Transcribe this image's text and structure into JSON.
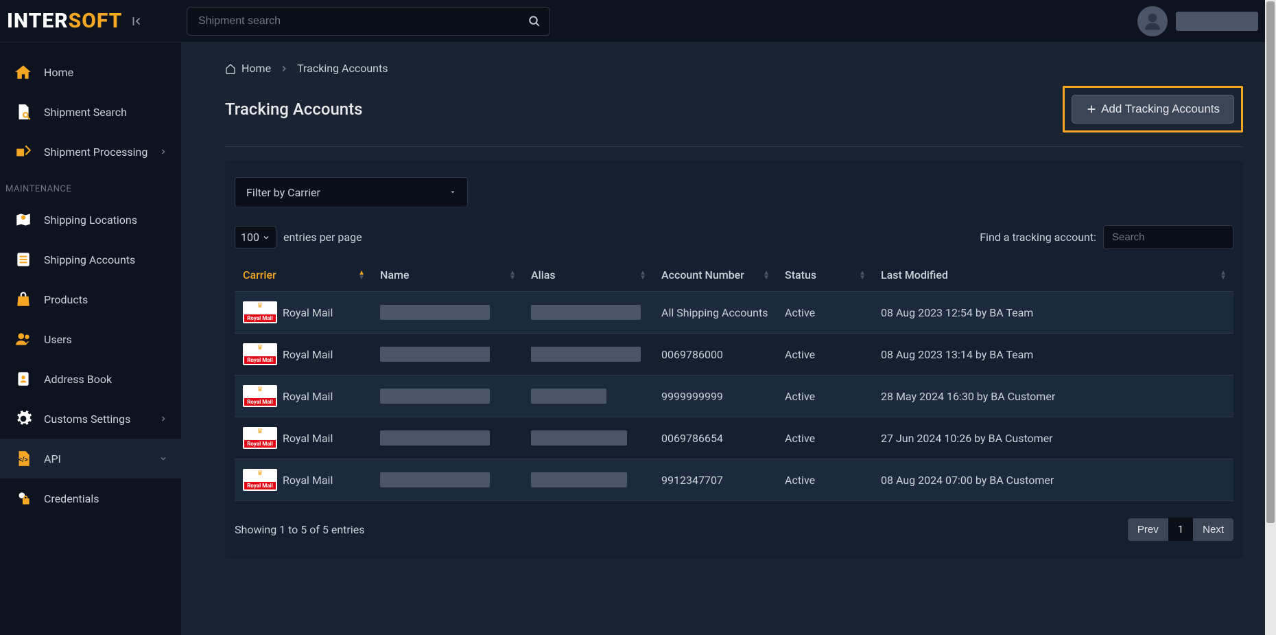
{
  "brand": {
    "part1": "INTER",
    "part2": "SOFT"
  },
  "topbar": {
    "search_placeholder": "Shipment search"
  },
  "sidebar": {
    "items_top": [
      {
        "label": "Home",
        "icon": "home"
      },
      {
        "label": "Shipment Search",
        "icon": "file-search"
      },
      {
        "label": "Shipment Processing",
        "icon": "process",
        "chevron": true
      }
    ],
    "section_label": "MAINTENANCE",
    "items_maint": [
      {
        "label": "Shipping Locations",
        "icon": "map-pin"
      },
      {
        "label": "Shipping Accounts",
        "icon": "list"
      },
      {
        "label": "Products",
        "icon": "bag"
      },
      {
        "label": "Users",
        "icon": "users"
      },
      {
        "label": "Address Book",
        "icon": "book"
      },
      {
        "label": "Customs Settings",
        "icon": "gear",
        "chevron": true
      },
      {
        "label": "API",
        "icon": "code",
        "chevron": true,
        "active": true
      },
      {
        "label": "Credentials",
        "icon": "lock"
      }
    ]
  },
  "breadcrumb": {
    "home": "Home",
    "current": "Tracking Accounts"
  },
  "page": {
    "title": "Tracking Accounts",
    "add_button": "Add Tracking Accounts"
  },
  "filter": {
    "label": "Filter by Carrier"
  },
  "table_controls": {
    "entries_value": "100",
    "entries_label": "entries per page",
    "find_label": "Find a tracking account:",
    "find_placeholder": "Search"
  },
  "table": {
    "headers": [
      "Carrier",
      "Name",
      "Alias",
      "Account Number",
      "Status",
      "Last Modified"
    ],
    "sorted_col": 0,
    "rows": [
      {
        "carrier": "Royal Mail",
        "account": "All Shipping Accounts",
        "status": "Active",
        "modified": "08 Aug 2023 12:54 by BA Team"
      },
      {
        "carrier": "Royal Mail",
        "account": "0069786000",
        "status": "Active",
        "modified": "08 Aug 2023 13:14 by BA Team"
      },
      {
        "carrier": "Royal Mail",
        "account": "9999999999",
        "status": "Active",
        "modified": "28 May 2024 16:30 by BA Customer"
      },
      {
        "carrier": "Royal Mail",
        "account": "0069786654",
        "status": "Active",
        "modified": "27 Jun 2024 10:26 by BA Customer"
      },
      {
        "carrier": "Royal Mail",
        "account": "9912347707",
        "status": "Active",
        "modified": "08 Aug 2024 07:00 by BA Customer"
      }
    ]
  },
  "footer": {
    "showing": "Showing 1 to 5 of 5 entries",
    "prev": "Prev",
    "page": "1",
    "next": "Next"
  }
}
